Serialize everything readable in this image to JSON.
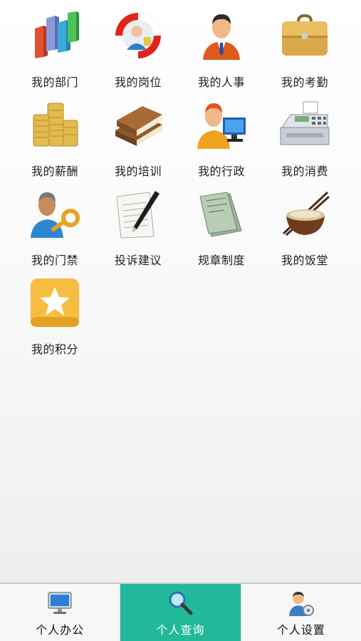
{
  "grid": {
    "items": [
      {
        "label": "我的部门",
        "icon": "department-chart-icon"
      },
      {
        "label": "我的岗位",
        "icon": "lifebuoy-person-icon"
      },
      {
        "label": "我的人事",
        "icon": "businessman-icon"
      },
      {
        "label": "我的考勤",
        "icon": "briefcase-icon"
      },
      {
        "label": "我的薪酬",
        "icon": "coin-stacks-icon"
      },
      {
        "label": "我的培训",
        "icon": "books-icon"
      },
      {
        "label": "我的行政",
        "icon": "person-computer-icon"
      },
      {
        "label": "我的消费",
        "icon": "cash-register-icon"
      },
      {
        "label": "我的门禁",
        "icon": "person-key-icon"
      },
      {
        "label": "投诉建议",
        "icon": "paper-pen-icon"
      },
      {
        "label": "规章制度",
        "icon": "documents-icon"
      },
      {
        "label": "我的饭堂",
        "icon": "noodle-bowl-icon"
      },
      {
        "label": "我的积分",
        "icon": "star-badge-icon"
      }
    ]
  },
  "tabbar": {
    "tabs": [
      {
        "label": "个人办公",
        "icon": "monitor-icon",
        "active": false
      },
      {
        "label": "个人查询",
        "icon": "magnifier-icon",
        "active": true
      },
      {
        "label": "个人设置",
        "icon": "user-settings-icon",
        "active": false
      }
    ],
    "active_color": "#22b99a"
  }
}
